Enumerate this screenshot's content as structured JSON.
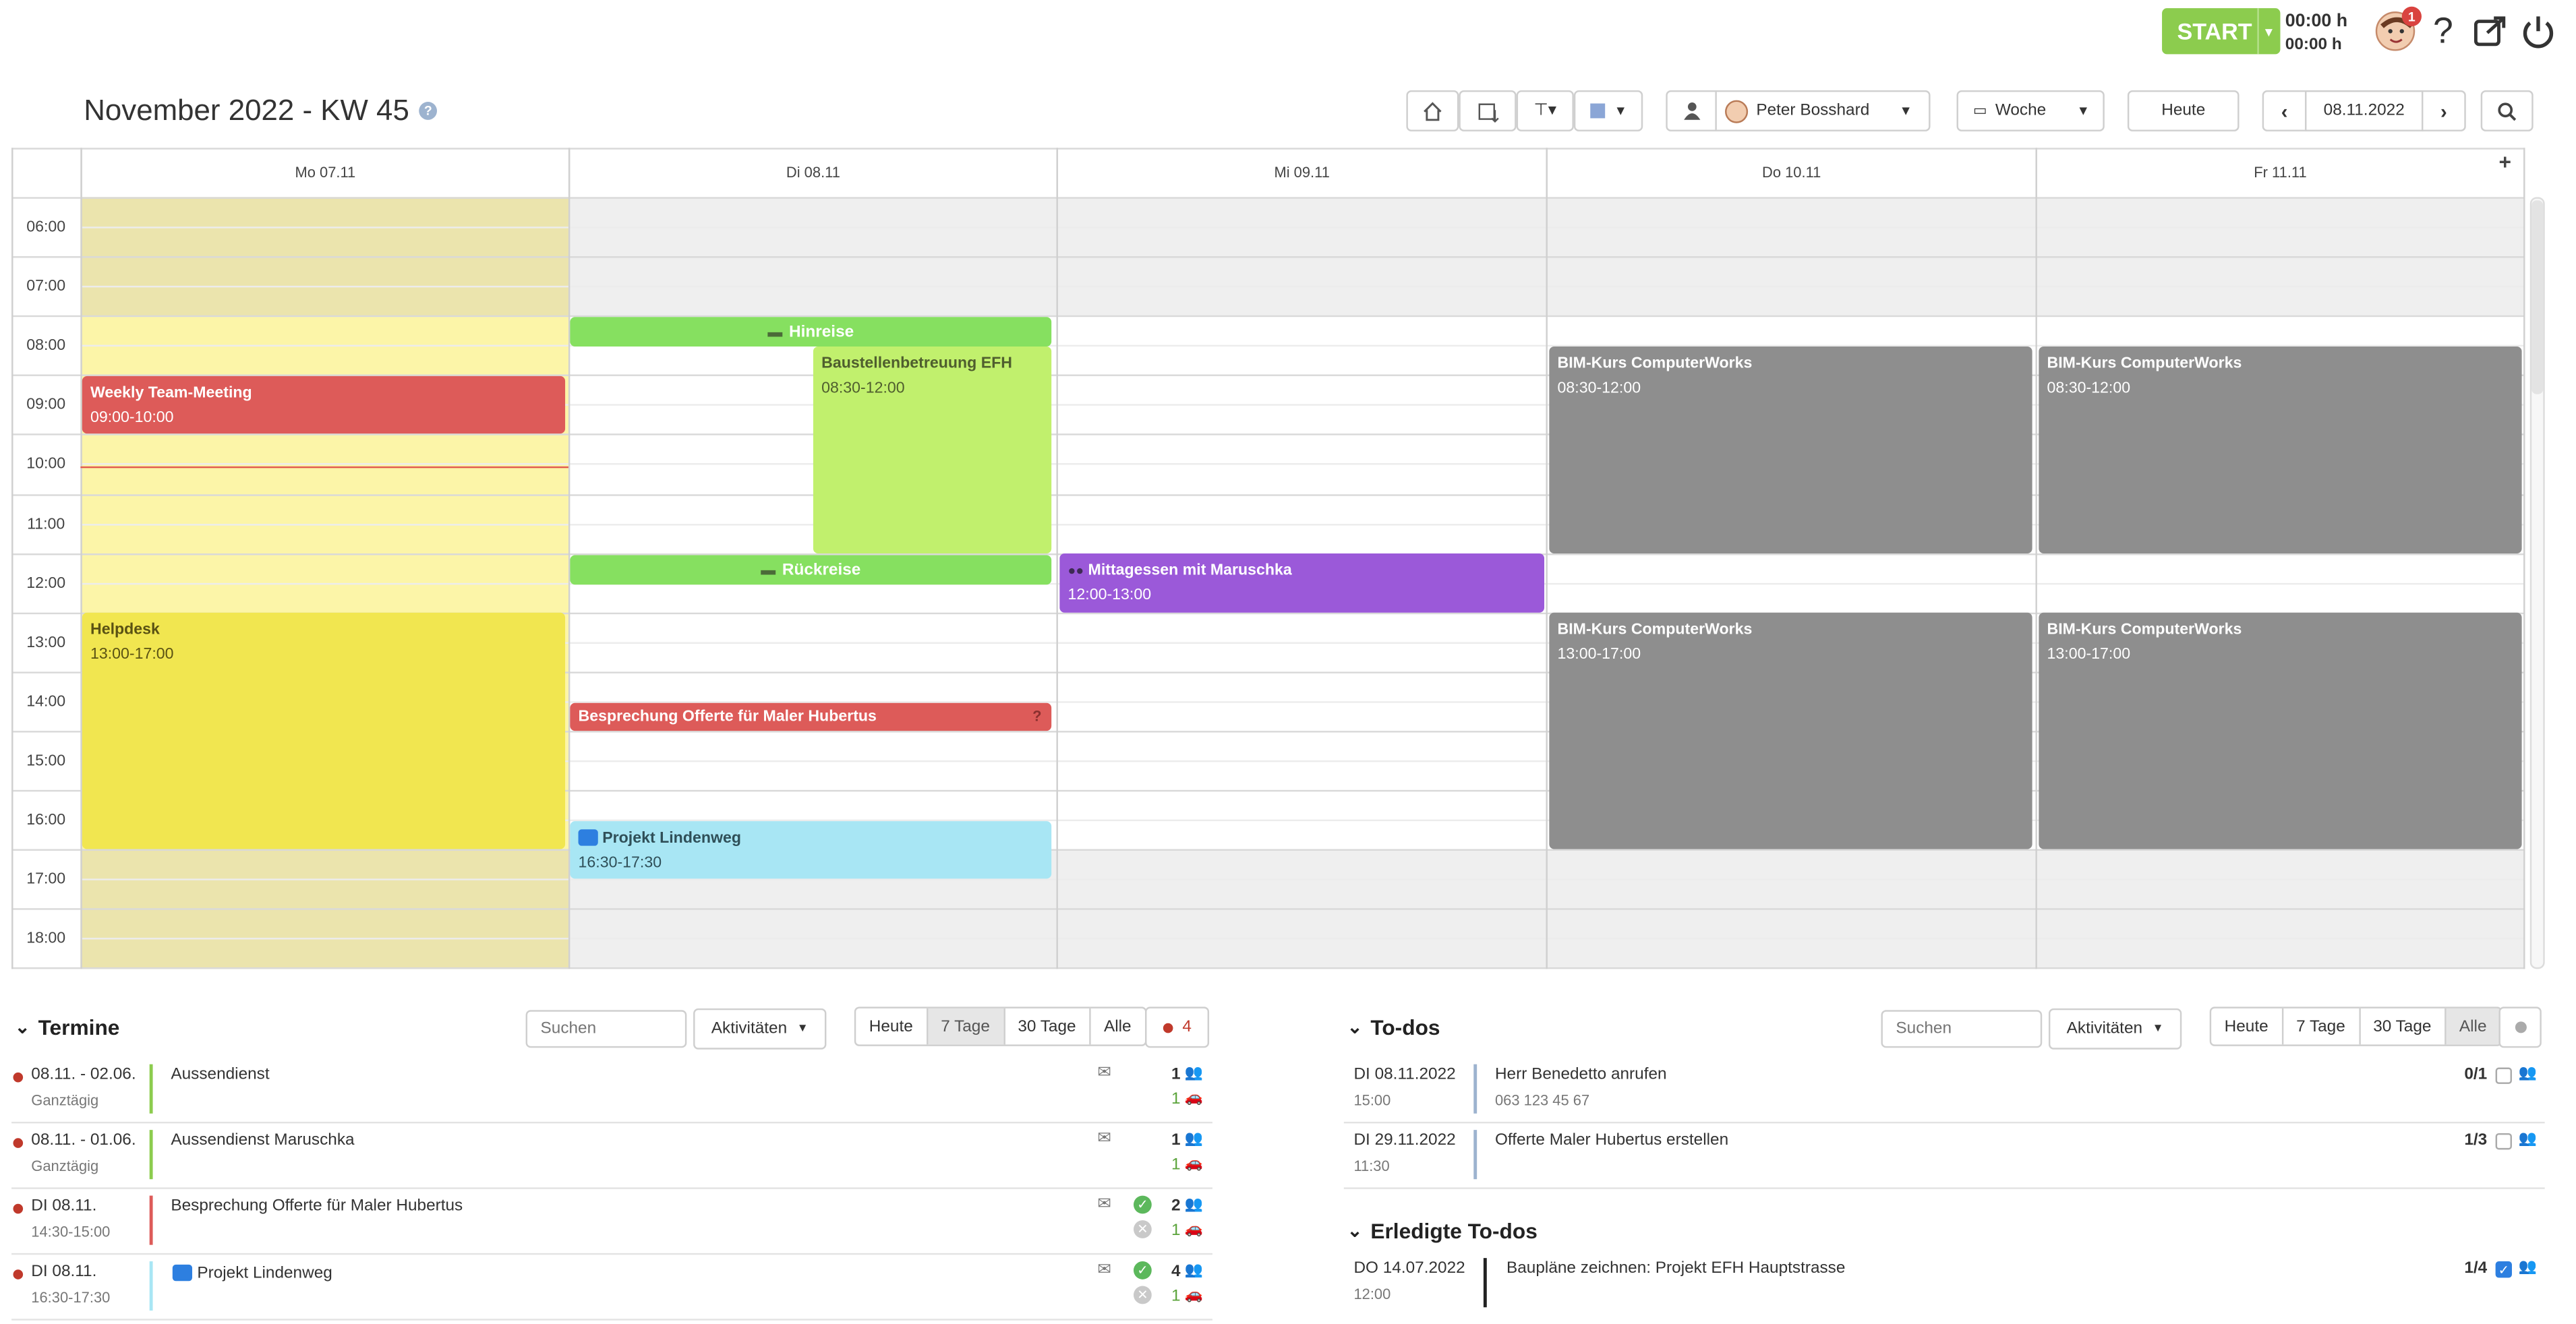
{
  "topbar": {
    "start_label": "START",
    "time_top": "00:00 h",
    "time_bottom": "00:00 h",
    "notification_count": "1"
  },
  "header": {
    "title": "November 2022 - KW 45",
    "user_name": "Peter Bosshard",
    "view": "Woche",
    "today_button": "Heute",
    "date": "08.11.2022"
  },
  "calendar": {
    "days": [
      "Mo 07.11",
      "Di 08.11",
      "Mi 09.11",
      "Do 10.11",
      "Fr 11.11"
    ],
    "hours": [
      "06:00",
      "07:00",
      "08:00",
      "09:00",
      "10:00",
      "11:00",
      "12:00",
      "13:00",
      "14:00",
      "15:00",
      "16:00",
      "17:00",
      "18:00"
    ],
    "events": {
      "team_meeting": {
        "title": "Weekly Team-Meeting",
        "time": "09:00-10:00"
      },
      "helpdesk": {
        "title": "Helpdesk",
        "time": "13:00-17:00"
      },
      "hinreise": {
        "title": "Hinreise"
      },
      "baustelle": {
        "title": "Baustellenbetreuung EFH",
        "time": "08:30-12:00"
      },
      "rueckreise": {
        "title": "Rückreise"
      },
      "besprechung": {
        "title": "Besprechung Offerte für Maler Hubertus",
        "flag": "?"
      },
      "lindenweg": {
        "title": "Projekt Lindenweg",
        "time": "16:30-17:30"
      },
      "mittagessen": {
        "title": "Mittagessen mit Maruschka",
        "time": "12:00-13:00"
      },
      "bim_do_am": {
        "title": "BIM-Kurs ComputerWorks",
        "time": "08:30-12:00"
      },
      "bim_fr_am": {
        "title": "BIM-Kurs ComputerWorks",
        "time": "08:30-12:00"
      },
      "bim_do_pm": {
        "title": "BIM-Kurs ComputerWorks",
        "time": "13:00-17:00"
      },
      "bim_fr_pm": {
        "title": "BIM-Kurs ComputerWorks",
        "time": "13:00-17:00"
      }
    }
  },
  "termine": {
    "title": "Termine",
    "search_placeholder": "Suchen",
    "filter": "Aktivitäten",
    "ranges": [
      "Heute",
      "7 Tage",
      "30 Tage",
      "Alle"
    ],
    "badge_count": "4",
    "rows": [
      {
        "date": "08.11. - 02.06.",
        "sub": "Ganztägig",
        "title": "Aussendienst",
        "count1": "1",
        "count2": "1"
      },
      {
        "date": "08.11. - 01.06.",
        "sub": "Ganztägig",
        "title": "Aussendienst Maruschka",
        "count1": "1",
        "count2": "1"
      },
      {
        "date": "DI 08.11.",
        "sub": "14:30-15:00",
        "title": "Besprechung Offerte für Maler Hubertus",
        "count1": "2",
        "count2": "1"
      },
      {
        "date": "DI 08.11.",
        "sub": "16:30-17:30",
        "title": "Projekt Lindenweg",
        "count1": "4",
        "count2": "1"
      }
    ]
  },
  "todos": {
    "title": "To-dos",
    "search_placeholder": "Suchen",
    "filter": "Aktivitäten",
    "ranges": [
      "Heute",
      "7 Tage",
      "30 Tage",
      "Alle"
    ],
    "rows": [
      {
        "date": "DI 08.11.2022",
        "sub": "15:00",
        "title": "Herr Benedetto anrufen",
        "detail": "063 123 45 67",
        "progress": "0/1"
      },
      {
        "date": "DI 29.11.2022",
        "sub": "11:30",
        "title": "Offerte Maler Hubertus erstellen",
        "detail": "",
        "progress": "1/3"
      }
    ],
    "done_title": "Erledigte To-dos",
    "done_rows": [
      {
        "date": "DO 14.07.2022",
        "sub": "12:00",
        "title": "Baupläne zeichnen: Projekt EFH Hauptstrasse",
        "progress": "1/4"
      }
    ]
  },
  "colors": {
    "accent_green": "#8ccc4e",
    "red": "#dd5b59",
    "gray": "#8e8e8e",
    "purple": "#9b59d9",
    "cyan": "#a8e6f4",
    "yellow": "#f1e650",
    "lime": "#c1f06d"
  }
}
